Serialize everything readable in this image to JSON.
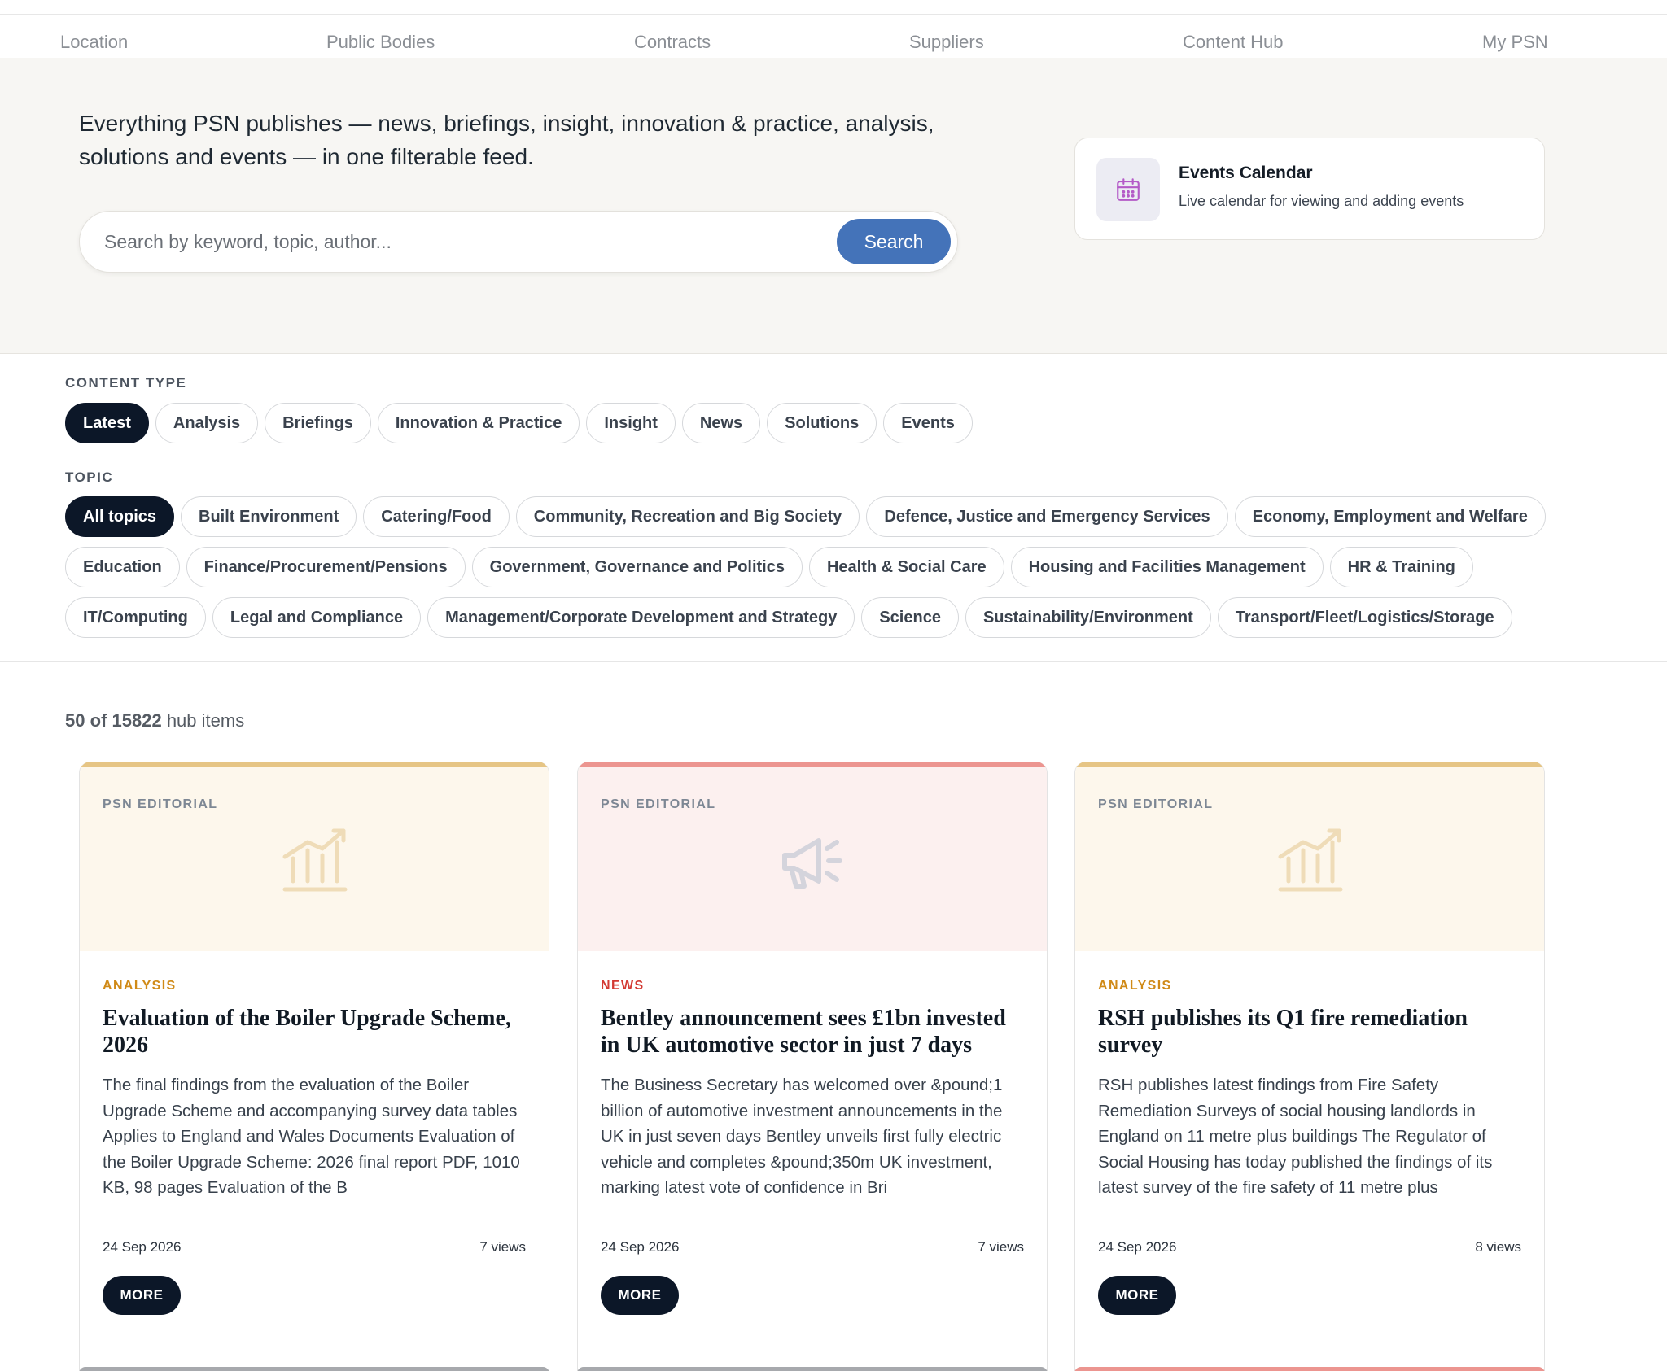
{
  "nav": {
    "items": [
      {
        "label": "Location"
      },
      {
        "label": "Public Bodies"
      },
      {
        "label": "Contracts"
      },
      {
        "label": "Suppliers"
      },
      {
        "label": "Content Hub",
        "active": true
      },
      {
        "label": "My PSN"
      }
    ],
    "active_color": "#c9957a"
  },
  "hero": {
    "intro": "Everything PSN publishes — news, briefings, insight, innovation & practice, analysis, solutions and events — in one filterable feed.",
    "search": {
      "placeholder": "Search by keyword, topic, author...",
      "value": "",
      "button_label": "Search",
      "button_color": "#4473b9"
    },
    "events_card": {
      "icon": "calendar-icon",
      "title": "Events Calendar",
      "subtitle": "Live calendar for viewing and adding events"
    }
  },
  "filters": {
    "content_type_label": "CONTENT TYPE",
    "content_types": [
      "Latest",
      "Analysis",
      "Briefings",
      "Innovation & Practice",
      "Insight",
      "News",
      "Solutions",
      "Events"
    ],
    "content_type_selected": "Latest",
    "topic_label": "TOPIC",
    "topics": [
      "All topics",
      "Built Environment",
      "Catering/Food",
      "Community, Recreation and Big Society",
      "Defence, Justice and Emergency Services",
      "Economy, Employment and Welfare",
      "Education",
      "Finance/Procurement/Pensions",
      "Government, Governance and Politics",
      "Health & Social Care",
      "Housing and Facilities Management",
      "HR & Training",
      "IT/Computing",
      "Legal and Compliance",
      "Management/Corporate Development and Strategy",
      "Science",
      "Sustainability/Environment",
      "Transport/Fleet/Logistics/Storage"
    ],
    "topic_selected": "All topics"
  },
  "results": {
    "shown": "50",
    "of": "of",
    "total": "15822",
    "suffix": "hub items",
    "cards": [
      {
        "source": "PSN EDITORIAL",
        "type": "ANALYSIS",
        "type_color": "#d08a17",
        "stripe_color": "#e6c585",
        "media_bg": "#fdf7ec",
        "art_icon": "chart-icon",
        "title": "Evaluation of the Boiler Upgrade Scheme, 2026",
        "description": "The final findings from the evaluation of the Boiler Upgrade Scheme and accompanying survey data tables Applies to England and Wales Documents Evaluation of the Boiler Upgrade Scheme: 2026 final report PDF, 1010 KB, 98 pages Evaluation of the B",
        "date": "24 Sep 2026",
        "views": "7 views",
        "button": "MORE"
      },
      {
        "source": "PSN EDITORIAL",
        "type": "NEWS",
        "type_color": "#d33a33",
        "stripe_color": "#ec9590",
        "media_bg": "#fcf0ef",
        "art_icon": "megaphone-icon",
        "title": "Bentley announcement sees £1bn invested in UK automotive sector in just 7 days",
        "description": "The Business Secretary has welcomed over &pound;1 billion of automotive investment announcements in the UK in just seven days Bentley unveils first fully electric vehicle and completes &pound;350m UK investment, marking latest vote of confidence in Bri",
        "date": "24 Sep 2026",
        "views": "7 views",
        "button": "MORE"
      },
      {
        "source": "PSN EDITORIAL",
        "type": "ANALYSIS",
        "type_color": "#d08a17",
        "stripe_color": "#e6c585",
        "media_bg": "#fdf7ec",
        "art_icon": "chart-icon",
        "title": "RSH publishes its Q1 fire remediation survey",
        "description": "RSH publishes latest findings from Fire Safety Remediation Surveys of social housing landlords in England on 11 metre plus buildings The Regulator of Social Housing has today published the findings of its latest survey of the fire safety of 11 metre plus",
        "date": "24 Sep 2026",
        "views": "8 views",
        "button": "MORE"
      }
    ],
    "next_row_stripes": [
      "#a7a9ad",
      "#a7a9ad",
      "#ec9590"
    ]
  }
}
